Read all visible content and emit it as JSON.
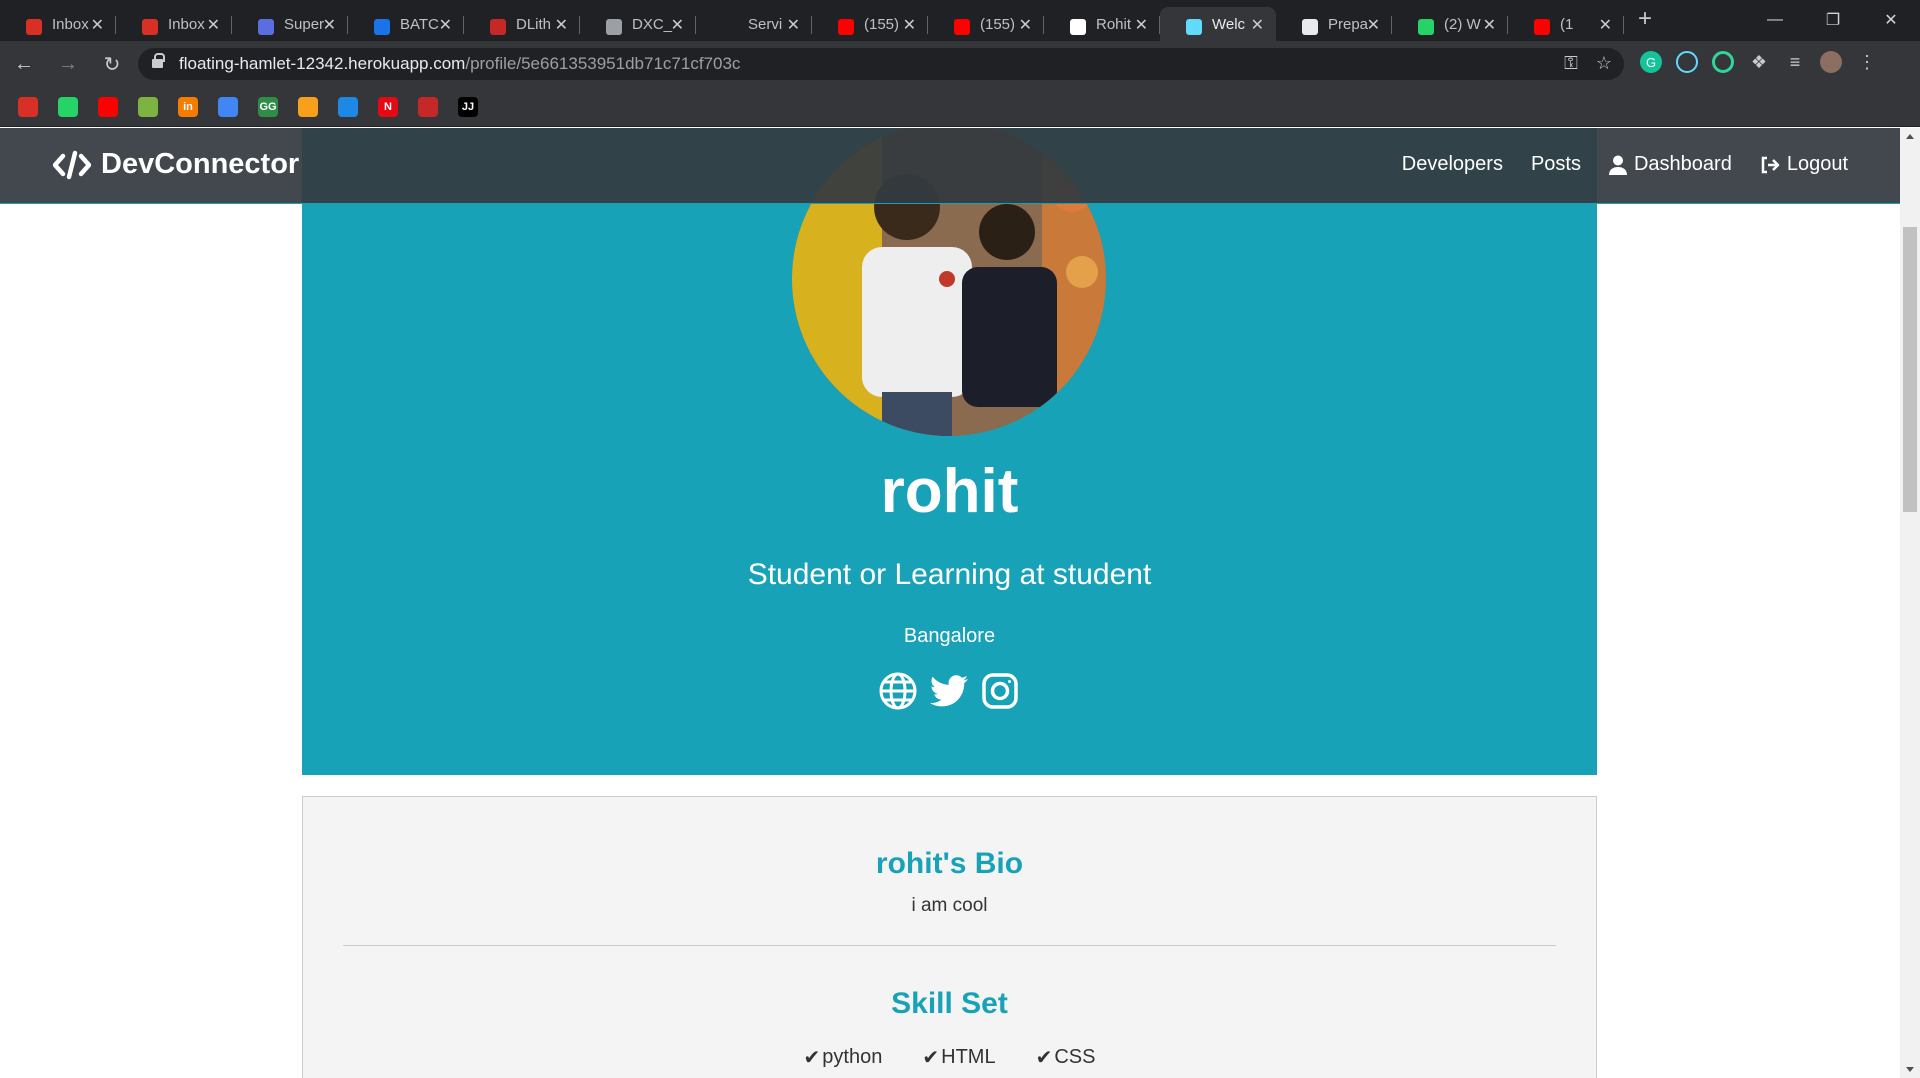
{
  "browser": {
    "tabs": [
      {
        "title": "Inbox",
        "favicon_color": "#d93025",
        "icon": "gmail-icon"
      },
      {
        "title": "Inbox",
        "favicon_color": "#d93025",
        "icon": "gmail-icon"
      },
      {
        "title": "Super",
        "favicon_color": "#5b6ee1",
        "icon": "super-icon"
      },
      {
        "title": "BATC",
        "favicon_color": "#1a73e8",
        "icon": "batch-icon"
      },
      {
        "title": "DLith",
        "favicon_color": "#c62828",
        "icon": "dlith-icon"
      },
      {
        "title": "DXC_",
        "favicon_color": "#9aa0a6",
        "icon": "globe-icon"
      },
      {
        "title": "Servi",
        "favicon_color": "#202124",
        "icon": "service-icon"
      },
      {
        "title": "(155)",
        "favicon_color": "#ff0000",
        "icon": "youtube-icon"
      },
      {
        "title": "(155)",
        "favicon_color": "#ff0000",
        "icon": "youtube-icon"
      },
      {
        "title": "Rohit",
        "favicon_color": "#ffffff",
        "icon": "github-icon"
      },
      {
        "title": "Welc",
        "favicon_color": "#61dafb",
        "icon": "react-icon",
        "active": true
      },
      {
        "title": "Prepa",
        "favicon_color": "#e8eaed",
        "icon": "prepa-icon"
      },
      {
        "title": "(2) W",
        "favicon_color": "#25d366",
        "icon": "whatsapp-icon"
      },
      {
        "title": "(1",
        "favicon_color": "#ff0000",
        "icon": "youtube-icon"
      }
    ],
    "url_host": "floating-hamlet-12342.herokuapp.com",
    "url_path": "/profile/5e661353951db71c71cf703c",
    "bookmarks": [
      {
        "name": "gmail",
        "color": "#d93025",
        "label": ""
      },
      {
        "name": "whatsapp",
        "color": "#25d366",
        "label": ""
      },
      {
        "name": "youtube",
        "color": "#ff0000",
        "label": ""
      },
      {
        "name": "play",
        "color": "#7cb342",
        "label": ""
      },
      {
        "name": "in",
        "color": "#f57c00",
        "label": "in"
      },
      {
        "name": "docs",
        "color": "#4285f4",
        "label": ""
      },
      {
        "name": "gfg",
        "color": "#2f8d46",
        "label": "GG"
      },
      {
        "name": "hackerrank",
        "color": "#f89f1b",
        "label": ""
      },
      {
        "name": "cycle",
        "color": "#1e88e5",
        "label": ""
      },
      {
        "name": "netflix",
        "color": "#e50914",
        "label": "N"
      },
      {
        "name": "speed",
        "color": "#c62828",
        "label": ""
      },
      {
        "name": "jj",
        "color": "#000000",
        "label": "JJ"
      }
    ]
  },
  "navbar": {
    "brand": "DevConnector",
    "links": {
      "developers": "Developers",
      "posts": "Posts",
      "dashboard": "Dashboard",
      "logout": "Logout"
    }
  },
  "profile": {
    "name": "rohit",
    "headline": "Student or Learning at student",
    "location": "Bangalore",
    "social": [
      "globe-icon",
      "twitter-icon",
      "instagram-icon"
    ]
  },
  "about": {
    "bio_title": "rohit's Bio",
    "bio": "i am cool",
    "skills_title": "Skill Set",
    "skills": [
      "python",
      "HTML",
      "CSS"
    ]
  },
  "colors": {
    "primary": "#17a2b8",
    "dark": "#343a40",
    "light": "#f4f4f4"
  }
}
